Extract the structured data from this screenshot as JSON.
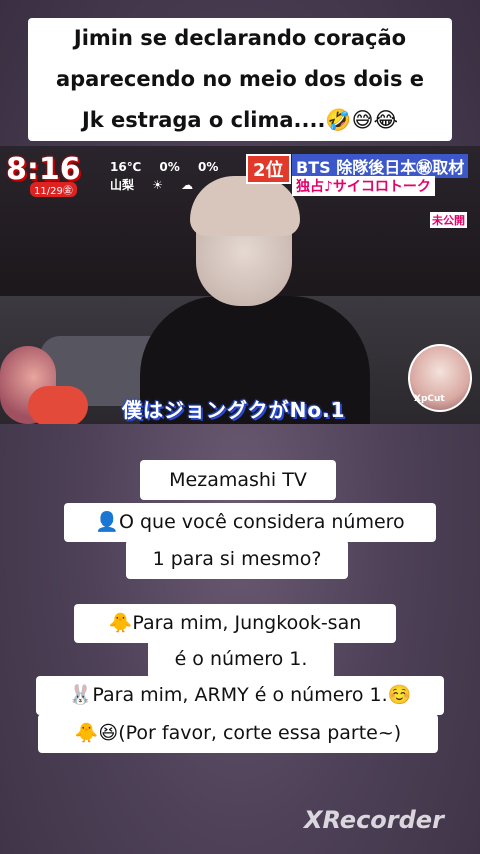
{
  "top_caption": {
    "line1": "Jimin se declarando coração",
    "line2": "aparecendo no meio dos dois e",
    "line3": "Jk estraga o clima....🤣😅😂"
  },
  "video": {
    "clock": "8:16",
    "date": "11/29㊎",
    "weather": {
      "temp": "16℃",
      "rain1": "0%",
      "rain2": "0%",
      "city": "山梨"
    },
    "rank": "2位",
    "banner": "BTS 除隊後日本㊙取材",
    "banner_sub": "独占♪サイコロトーク",
    "unreleased": "未公開",
    "subtitle": "僕はジョングクがNo.1",
    "inset_label": "XpCut"
  },
  "interview": {
    "line1": "Mezamashi TV",
    "line2": "👤O que você considera número",
    "line3": "1 para si mesmo?",
    "line4": "🐥Para mim, Jungkook-san",
    "line5": "é o número 1.",
    "line6": "🐰Para mim, ARMY é o número 1.☺️",
    "line7": "🐥😆(Por favor, corte essa parte~)"
  },
  "watermark": "XRecorder"
}
